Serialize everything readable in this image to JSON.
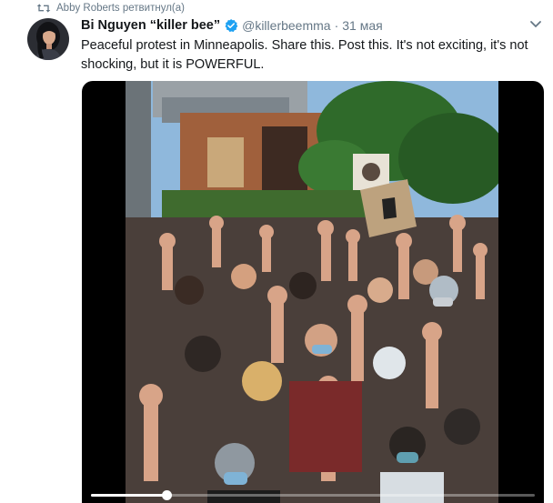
{
  "retweet": {
    "text": "Abby Roberts ретвитнул(а)"
  },
  "tweet": {
    "display_name": "Bi Nguyen “killer bee”",
    "handle": "@killerbeemma",
    "separator": "·",
    "date": "31 мая",
    "text": "Peaceful protest in Minneapolis. Share this. Post this. It's not exciting, it's not shocking, but it is POWERFUL."
  },
  "media": {
    "type": "video",
    "progress_fraction": 0.17
  },
  "icons": {
    "retweet": "retweet-icon",
    "verified": "verified-badge-icon",
    "menu": "chevron-down-icon"
  },
  "colors": {
    "secondary_text": "#657786",
    "primary_text": "#14171a",
    "verified": "#1da1f2"
  }
}
